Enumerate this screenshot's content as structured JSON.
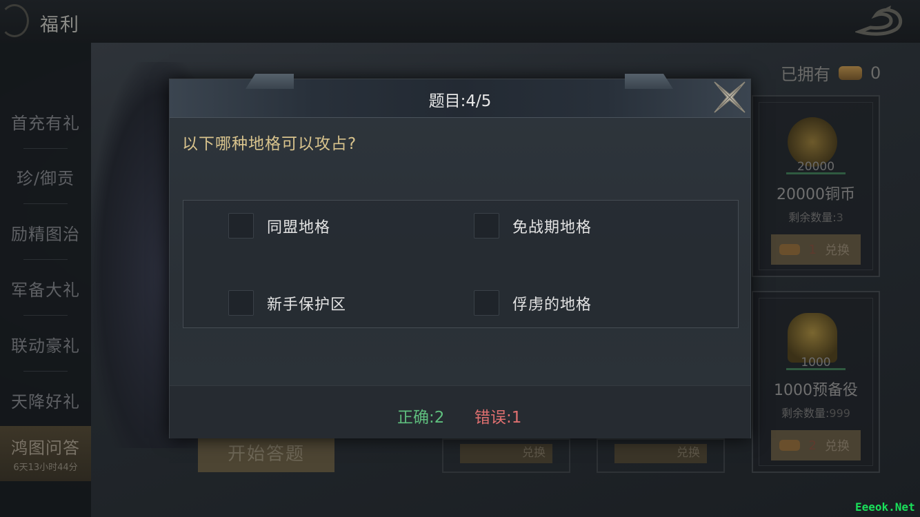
{
  "topbar": {
    "title": "福利"
  },
  "sidebar": {
    "items": [
      {
        "label": "首充有礼"
      },
      {
        "label": "珍/御贡"
      },
      {
        "label": "励精图治"
      },
      {
        "label": "军备大礼"
      },
      {
        "label": "联动豪礼"
      },
      {
        "label": "天降好礼"
      },
      {
        "label": "鸿图问答",
        "sub": "6天13小时44分"
      }
    ]
  },
  "owned": {
    "label": "已拥有",
    "value": "0"
  },
  "shop": {
    "cards": [
      {
        "qty": "20000",
        "name": "20000铜币",
        "remain_label": "剩余数量:",
        "remain_value": "3",
        "btn_cost": "1",
        "btn_label": "兑换"
      },
      {
        "qty": "1000",
        "name": "1000预备役",
        "remain_label": "剩余数量:",
        "remain_value": "999",
        "btn_cost": "2",
        "btn_label": "兑换"
      }
    ],
    "bottom_buttons": [
      {
        "label": "兑换"
      },
      {
        "label": "兑换"
      }
    ]
  },
  "start_button": {
    "label": "开始答题"
  },
  "modal": {
    "title": "题目:4/5",
    "question": "以下哪种地格可以攻占?",
    "options": [
      {
        "label": "同盟地格",
        "checked": false
      },
      {
        "label": "免战期地格",
        "checked": false
      },
      {
        "label": "新手保护区",
        "checked": false
      },
      {
        "label": "俘虏的地格",
        "checked": false
      }
    ],
    "score": {
      "correct": "正确:2",
      "wrong": "错误:1"
    }
  },
  "watermark": "Eeeok.Net",
  "colors": {
    "question": "#d9c48d",
    "correct": "#5fbf7e",
    "wrong": "#e07070"
  },
  "icons": {
    "close": "close-x-icon",
    "back": "back-icon",
    "logo": "dragon-logo-icon"
  }
}
